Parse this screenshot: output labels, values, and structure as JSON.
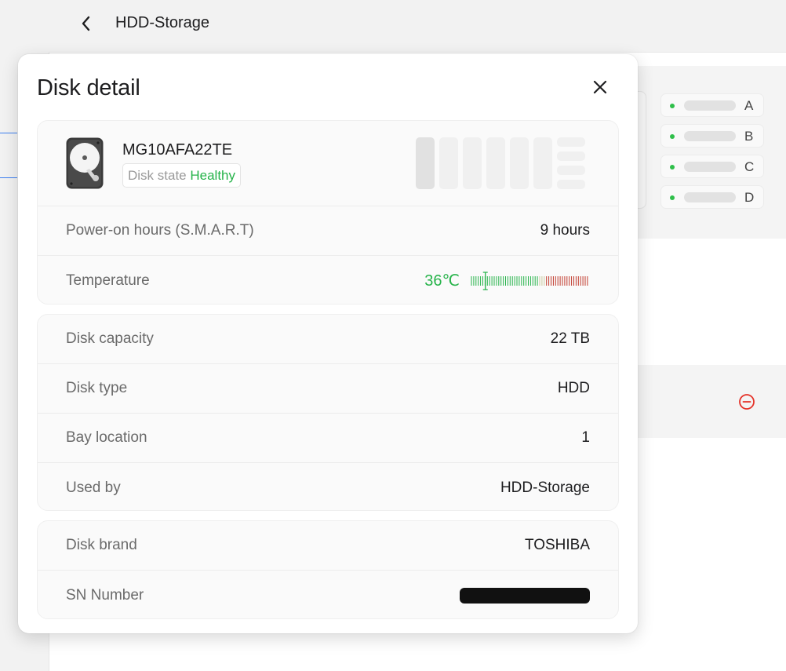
{
  "header": {
    "title": "HDD-Storage",
    "back_icon": "chevron-left-icon"
  },
  "background": {
    "bays": [
      {
        "letter": "A",
        "status_color": "#2fbf4a"
      },
      {
        "letter": "B",
        "status_color": "#2fbf4a"
      },
      {
        "letter": "C",
        "status_color": "#2fbf4a"
      },
      {
        "letter": "D",
        "status_color": "#2fbf4a"
      }
    ],
    "remove_icon": "minus-circle-icon",
    "remove_icon_color": "#e5332a"
  },
  "modal": {
    "title": "Disk detail",
    "close_icon": "close-icon",
    "disk": {
      "model": "MG10AFA22TE",
      "state_label": "Disk state",
      "state_value": "Healthy",
      "state_color": "#26b34a",
      "icon": "hard-disk-icon",
      "selected_bay": 1
    },
    "health": {
      "power_on_label": "Power-on hours (S.M.A.R.T)",
      "power_on_value": "9 hours",
      "temperature_label": "Temperature",
      "temperature_value": "36℃",
      "temperature_level": 0.12
    },
    "specs": {
      "capacity_label": "Disk capacity",
      "capacity_value": "22 TB",
      "type_label": "Disk type",
      "type_value": "HDD",
      "bay_label": "Bay location",
      "bay_value": "1",
      "used_by_label": "Used by",
      "used_by_value": "HDD-Storage"
    },
    "identity": {
      "brand_label": "Disk brand",
      "brand_value": "TOSHIBA",
      "sn_label": "SN Number",
      "sn_redacted": true
    }
  },
  "colors": {
    "healthy": "#26b34a",
    "temp_warm": "#c9c9a0",
    "temp_hot": "#c0392b",
    "accent": "#3d7ff0"
  }
}
